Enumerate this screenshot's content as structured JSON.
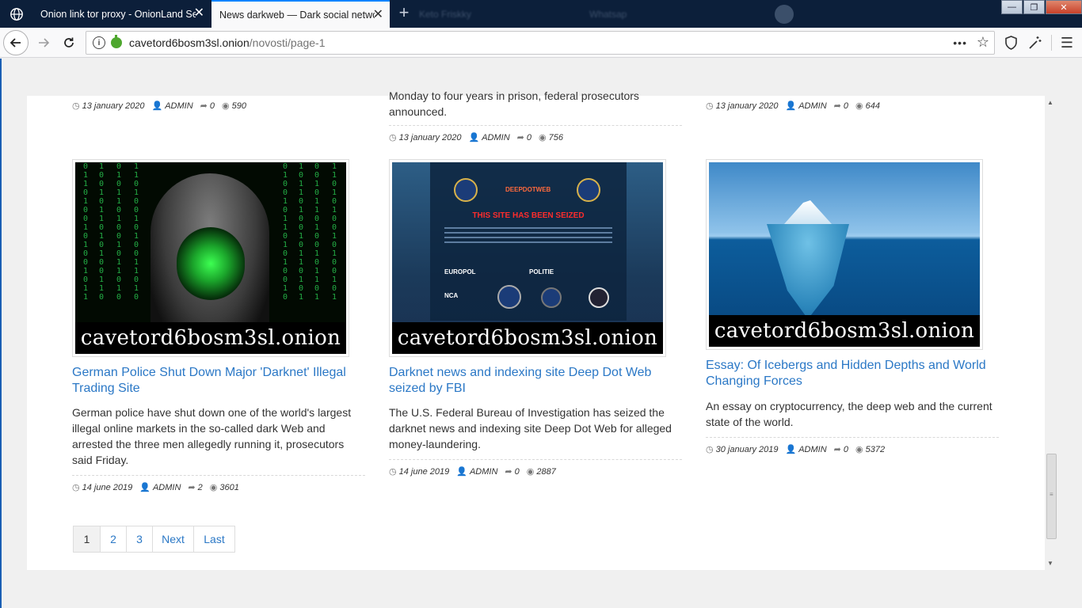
{
  "browser": {
    "tabs": [
      {
        "label": "Onion link tor proxy - OnionLand Se",
        "active": false
      },
      {
        "label": "News darkweb — Dark social netwo",
        "active": true
      }
    ],
    "ghost_tabs": [
      "Keto Friskky",
      "Whatsap"
    ],
    "url_host": "cavetord6bosm3sl.onion",
    "url_path": "/novosti/page-1"
  },
  "partial_article_text": [
    "Monday to four years in prison, federal prosecutors",
    "announced."
  ],
  "top_meta": [
    {
      "date": "13 january 2020",
      "author": "ADMIN",
      "shares": "0",
      "views": "590"
    },
    {
      "date": "13 january 2020",
      "author": "ADMIN",
      "shares": "0",
      "views": "756"
    },
    {
      "date": "13 january 2020",
      "author": "ADMIN",
      "shares": "0",
      "views": "644"
    }
  ],
  "articles": [
    {
      "title": "German Police Shut Down Major 'Darknet' Illegal Trading Site",
      "text": "German police have shut down one of the world's largest illegal online markets in the so-called dark Web and arrested the three men allegedly running it, prosecutors said Friday.",
      "date": "14 june 2019",
      "author": "ADMIN",
      "shares": "2",
      "views": "3601",
      "watermark": "cavetord6bosm3sl.onion"
    },
    {
      "title": "Darknet news and indexing site Deep Dot Web seized by FBI",
      "text": "The U.S. Federal Bureau of Investigation has seized the darknet news and indexing site Deep Dot Web for alleged money-laundering.",
      "date": "14 june 2019",
      "author": "ADMIN",
      "shares": "0",
      "views": "2887",
      "watermark": "cavetord6bosm3sl.onion",
      "image_text": {
        "headline": "THIS SITE HAS BEEN SEIZED",
        "logos": [
          "DEEPDOTWEB",
          "EUROPOL",
          "POLITIE",
          "NCA"
        ]
      }
    },
    {
      "title": "Essay: Of Icebergs and Hidden Depths and World Changing Forces",
      "text": "An essay on cryptocurrency, the deep web and the current state of the world.",
      "date": "30 january 2019",
      "author": "ADMIN",
      "shares": "0",
      "views": "5372",
      "watermark": "cavetord6bosm3sl.onion"
    }
  ],
  "pagination": [
    "1",
    "2",
    "3",
    "Next",
    "Last"
  ],
  "colors": {
    "link": "#2b78c6",
    "tab_active_border": "#0a84ff",
    "titlebar": "#0c1f3a"
  }
}
